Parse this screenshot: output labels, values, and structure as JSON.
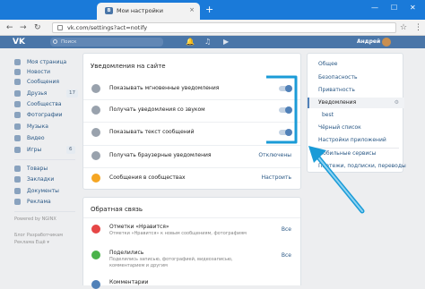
{
  "browser": {
    "tab_title": "Мои настройки",
    "tab_favicon": "vk-favicon",
    "new_tab": "+",
    "close_tab": "×",
    "minimize": "—",
    "maximize": "☐",
    "close_window": "✕",
    "back": "←",
    "forward": "→",
    "reload": "↻",
    "url": "vk.com/settings?act=notify",
    "star": "☆",
    "menu": "⋮",
    "accent": "#1a7ad9"
  },
  "vk_header": {
    "logo": "VK",
    "search_placeholder": "Поиск",
    "user_name": "Андрей",
    "bell_icon": "🔔",
    "music_icon": "♫",
    "play_icon": "▶",
    "accent": "#4a76a8"
  },
  "left_menu": {
    "items": [
      {
        "label": "Моя страница",
        "icon": "home-icon"
      },
      {
        "label": "Новости",
        "icon": "news-icon"
      },
      {
        "label": "Сообщения",
        "icon": "messages-icon"
      },
      {
        "label": "Друзья",
        "icon": "friends-icon",
        "count": "17"
      },
      {
        "label": "Сообщества",
        "icon": "groups-icon"
      },
      {
        "label": "Фотографии",
        "icon": "photos-icon"
      },
      {
        "label": "Музыка",
        "icon": "music-icon"
      },
      {
        "label": "Видео",
        "icon": "video-icon"
      },
      {
        "label": "Игры",
        "icon": "games-icon",
        "count": "6"
      }
    ],
    "items2": [
      {
        "label": "Товары",
        "icon": "market-icon"
      },
      {
        "label": "Закладки",
        "icon": "bookmarks-icon"
      },
      {
        "label": "Документы",
        "icon": "documents-icon"
      },
      {
        "label": "Реклама",
        "icon": "ads-icon"
      }
    ],
    "powered": "Powered by NGINX",
    "footer_line1": "Блог Разработчикам",
    "footer_line2": "Реклама Ещё ▾"
  },
  "site_notifications": {
    "title": "Уведомления на сайте",
    "rows": [
      {
        "label": "Показывать мгновенные уведомления",
        "icon": "bell-icon",
        "toggle": true
      },
      {
        "label": "Получать уведомления со звуком",
        "icon": "sound-icon",
        "toggle": true
      },
      {
        "label": "Показывать текст сообщений",
        "icon": "message-text-icon",
        "toggle": true
      },
      {
        "label": "Получать браузерные уведомления",
        "icon": "browser-bell-icon",
        "value": "Отключены"
      },
      {
        "label": "Сообщения в сообществах",
        "icon": "community-icon",
        "value": "Настроить"
      }
    ]
  },
  "feedback": {
    "title": "Обратная связь",
    "rows": [
      {
        "title": "Отметки «Нравится»",
        "subtitle": "Отметки «Нравится» к новым сообщениям, фотографиям",
        "value": "Все",
        "icon": "heart-icon",
        "color": "#e64646"
      },
      {
        "title": "Поделились",
        "subtitle": "Поделились записью, фотографией, видеозаписью,",
        "subtitle2": "комментарием и другим",
        "value": "Все",
        "icon": "share-icon",
        "color": "#4bb34b"
      },
      {
        "title": "Комментарии",
        "subtitle": "",
        "value": "",
        "icon": "comment-icon",
        "color": "#5181b8"
      }
    ]
  },
  "right_nav": {
    "items": [
      {
        "label": "Общее"
      },
      {
        "label": "Безопасность"
      },
      {
        "label": "Приватность"
      },
      {
        "label": "Уведомления",
        "active": true
      },
      {
        "label": "best",
        "sub": true
      },
      {
        "label": "Чёрный список"
      },
      {
        "label": "Настройки приложений"
      },
      {
        "label": "Мобильные сервисы"
      },
      {
        "label": "Платежи, подписки, переводы"
      }
    ]
  },
  "annotation": {
    "color": "#1a9bd7"
  }
}
